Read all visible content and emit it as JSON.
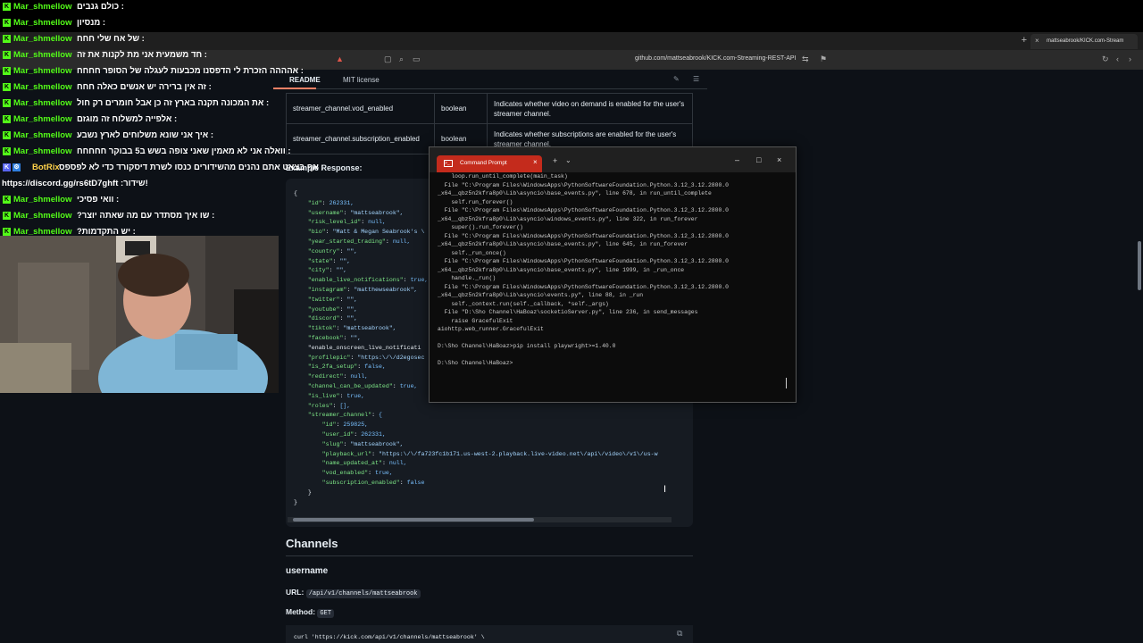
{
  "chat": {
    "messages": [
      {
        "user": "Mar_shmellow",
        "text": ": כולם גנבים"
      },
      {
        "user": "Mar_shmellow",
        "text": ": מנסיון"
      },
      {
        "user": "Mar_shmellow",
        "text": ": של אח שלי חחח"
      },
      {
        "user": "Mar_shmellow",
        "text": ": חד משמעית אני מת לקנות את זה"
      },
      {
        "user": "Mar_shmellow",
        "text": ": אהההה הזכרת לי הדפסנו מכבעות לעגלה של הסופר חחחח"
      },
      {
        "user": "Mar_shmellow",
        "text": ": זה אין ברירה יש אנשים כאלה חחח"
      },
      {
        "user": "Mar_shmellow",
        "text": ": את המכונה תקנה בארץ זה כן אבל חומרים רק חול"
      },
      {
        "user": "Mar_shmellow",
        "text": ": אלפייה למשלוח זה מוגזם"
      },
      {
        "user": "Mar_shmellow",
        "text": ": איך אני שונא משלוחים לארץ נשבע"
      },
      {
        "user": "Mar_shmellow",
        "text": ": וואלה אני לא מאמין שאני צופה בשש ב5 בבוקר חחחחח"
      },
      {
        "user": "BotRix",
        "text": ": אף בצאט אתם נהנים מהשידורים כנסו לשרת דיסקורד כדי לא לפספס"
      },
      {
        "user": "",
        "text": "!שידור: https://discord.gg/rs6tD7ghft"
      },
      {
        "user": "Mar_shmellow",
        "text": ": וואי פסיכי"
      },
      {
        "user": "Mar_shmellow",
        "text": ": שו איך מסתדר עם מה שאתה יוצר?"
      },
      {
        "user": "Mar_shmellow",
        "text": ": יש התקדמות?"
      }
    ]
  },
  "browser": {
    "tab_title": "mattseabrook/KICK.com-Stream",
    "url": "github.com/mattseabrook/KICK.com-Streaming-REST-API"
  },
  "readme": {
    "tab_readme": "README",
    "tab_license": "MIT license",
    "rows": [
      {
        "field": "streamer_channel.vod_enabled",
        "type": "boolean",
        "desc": "Indicates whether video on demand is enabled for the user's streamer channel."
      },
      {
        "field": "streamer_channel.subscription_enabled",
        "type": "boolean",
        "desc": "Indicates whether subscriptions are enabled for the user's streamer channel."
      }
    ],
    "example_heading": "Example Response:",
    "channels_heading": "Channels",
    "username_heading": "username",
    "url_label": "URL:",
    "url_value": "/api/v1/channels/mattseabrook",
    "method_label": "Method:",
    "method_value": "GET",
    "curl": "curl 'https://kick.com/api/v1/channels/mattseabrook' \\"
  },
  "cmd": {
    "title": "Command Prompt",
    "output": [
      "    loop.run_until_complete(main_task)",
      "  File \"C:\\Program Files\\WindowsApps\\PythonSoftwareFoundation.Python.3.12_3.12.2800.0",
      "_x64__qbz5n2kfra8p0\\Lib\\asyncio\\base_events.py\", line 678, in run_until_complete",
      "    self.run_forever()",
      "  File \"C:\\Program Files\\WindowsApps\\PythonSoftwareFoundation.Python.3.12_3.12.2800.0",
      "_x64__qbz5n2kfra8p0\\Lib\\asyncio\\windows_events.py\", line 322, in run_forever",
      "    super().run_forever()",
      "  File \"C:\\Program Files\\WindowsApps\\PythonSoftwareFoundation.Python.3.12_3.12.2800.0",
      "_x64__qbz5n2kfra8p0\\Lib\\asyncio\\base_events.py\", line 645, in run_forever",
      "    self._run_once()",
      "  File \"C:\\Program Files\\WindowsApps\\PythonSoftwareFoundation.Python.3.12_3.12.2800.0",
      "_x64__qbz5n2kfra8p0\\Lib\\asyncio\\base_events.py\", line 1999, in _run_once",
      "    handle._run()",
      "  File \"C:\\Program Files\\WindowsApps\\PythonSoftwareFoundation.Python.3.12_3.12.2800.0",
      "_x64__qbz5n2kfra8p0\\Lib\\asyncio\\events.py\", line 88, in _run",
      "    self._context.run(self._callback, *self._args)",
      "  File \"D:\\Sho Channel\\HaBoaz\\socketioServer.py\", line 236, in send_messages",
      "    raise GracefulExit",
      "aiohttp.web_runner.GracefulExit",
      "",
      "D:\\Sho Channel\\HaBoaz>pip install playwright>=1.40.0",
      "",
      "D:\\Sho Channel\\HaBoaz>"
    ]
  },
  "code_lines": [
    "{",
    "    \"id\": 262331,",
    "    \"username\": \"mattseabrook\",",
    "    \"risk_level_id\": null,",
    "    \"bio\": \"Matt & Megan Seabrook's \\",
    "    \"year_started_trading\": null,",
    "    \"country\": \"\",",
    "    \"state\": \"\",",
    "    \"city\": \"\",",
    "    \"enable_live_notifications\": true,",
    "    \"instagram\": \"matthewseabrook\",",
    "    \"twitter\": \"\",",
    "    \"youtube\": \"\",",
    "    \"discord\": \"\",",
    "    \"tiktok\": \"mattseabrook\",",
    "    \"facebook\": \"\",",
    "    \"enable_onscreen_live_notificati",
    "    \"profilepic\": \"https:\\/\\/d2egosec",
    "    \"is_2fa_setup\": false,",
    "    \"redirect\": null,",
    "    \"channel_can_be_updated\": true,",
    "    \"is_live\": true,",
    "    \"roles\": [],",
    "    \"streamer_channel\": {",
    "        \"id\": 259825,",
    "        \"user_id\": 262331,",
    "        \"slug\": \"mattseabrook\",",
    "        \"playback_url\": \"https:\\/\\/fa723fc1b171.us-west-2.playback.live-video.net\\/api\\/video\\/v1\\/us-w",
    "        \"name_updated_at\": null,",
    "        \"vod_enabled\": true,",
    "        \"subscription_enabled\": false",
    "    }",
    "}"
  ],
  "colors": {
    "kick_green": "#53fc18",
    "cmd_tab": "#c42b1c",
    "gh_bg": "#0d1117"
  }
}
